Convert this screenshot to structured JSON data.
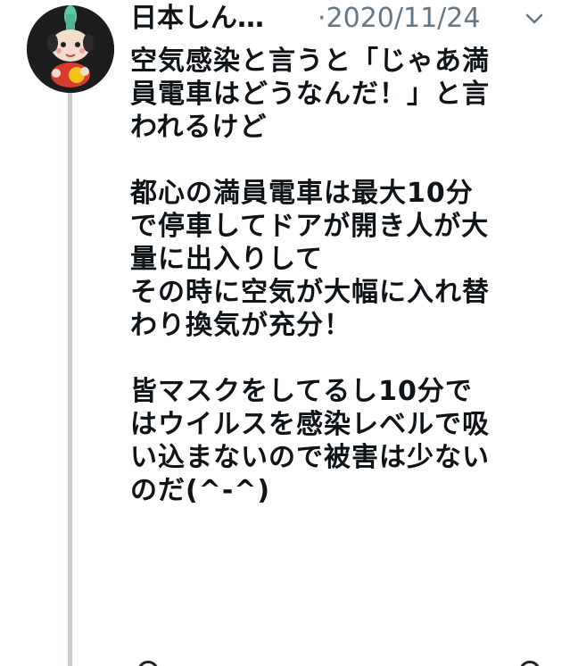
{
  "tweet": {
    "author_name": "日本しん…",
    "date": "·2020/11/24",
    "avatar_icon": "figurine-avatar-icon",
    "menu_icon": "chevron-down-icon",
    "lines": [
      "空気感染と言うと「じゃあ満",
      "員電車はどうなんだ！」と言",
      "われるけど",
      "",
      "都心の満員電車は最大10分",
      "で停車してドアが開き人が大",
      "量に出入りして",
      "その時に空気が大幅に入れ替",
      "わり換気が充分！",
      "",
      "皆マスクをしてるし10分で",
      "はウイルスを感染レベルで吸",
      "い込まないので被害は少ない",
      "のだ(^-^)"
    ]
  },
  "colors": {
    "text": "#0f1419",
    "secondary_text": "#657786",
    "thread_line": "#c8ccd1"
  }
}
